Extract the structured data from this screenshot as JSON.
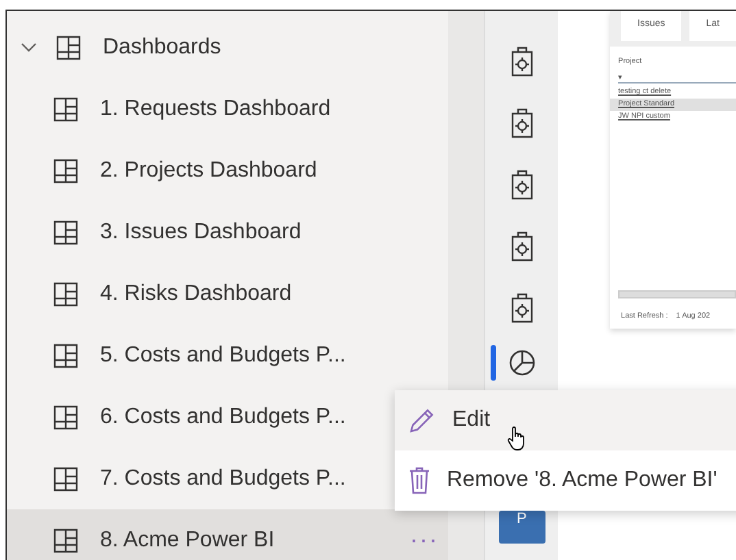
{
  "nav": {
    "header": {
      "label": "Dashboards",
      "expanded": true
    },
    "items": [
      {
        "label": "1. Requests Dashboard",
        "selected": false
      },
      {
        "label": "2. Projects Dashboard",
        "selected": false
      },
      {
        "label": "3. Issues Dashboard",
        "selected": false
      },
      {
        "label": "4. Risks Dashboard",
        "selected": false
      },
      {
        "label": "5. Costs and Budgets P...",
        "selected": false
      },
      {
        "label": "6. Costs and Budgets P...",
        "selected": false
      },
      {
        "label": "7. Costs and Budgets P...",
        "selected": false
      },
      {
        "label": "8. Acme Power BI",
        "selected": true
      }
    ],
    "more_button": "···"
  },
  "icon_column": {
    "items": [
      {
        "kind": "report",
        "selected": false
      },
      {
        "kind": "report",
        "selected": false
      },
      {
        "kind": "report",
        "selected": false
      },
      {
        "kind": "report",
        "selected": false
      },
      {
        "kind": "report",
        "selected": false
      },
      {
        "kind": "pie",
        "selected": true
      }
    ],
    "tile": "P"
  },
  "preview": {
    "tabs": [
      "Issues",
      "Lat"
    ],
    "filter_label": "Project",
    "dropdown": "▾",
    "links": [
      {
        "label": "testing ct delete",
        "selected": false
      },
      {
        "label": "Project Standard",
        "selected": true
      },
      {
        "label": "JW NPI custom",
        "selected": false
      }
    ],
    "refresh_label": "Last Refresh :",
    "refresh_date": "1 Aug 202"
  },
  "context_menu": {
    "items": [
      {
        "kind": "edit",
        "label": "Edit",
        "hovered": true
      },
      {
        "kind": "remove",
        "label": "Remove '8. Acme Power BI'",
        "hovered": false
      }
    ]
  }
}
